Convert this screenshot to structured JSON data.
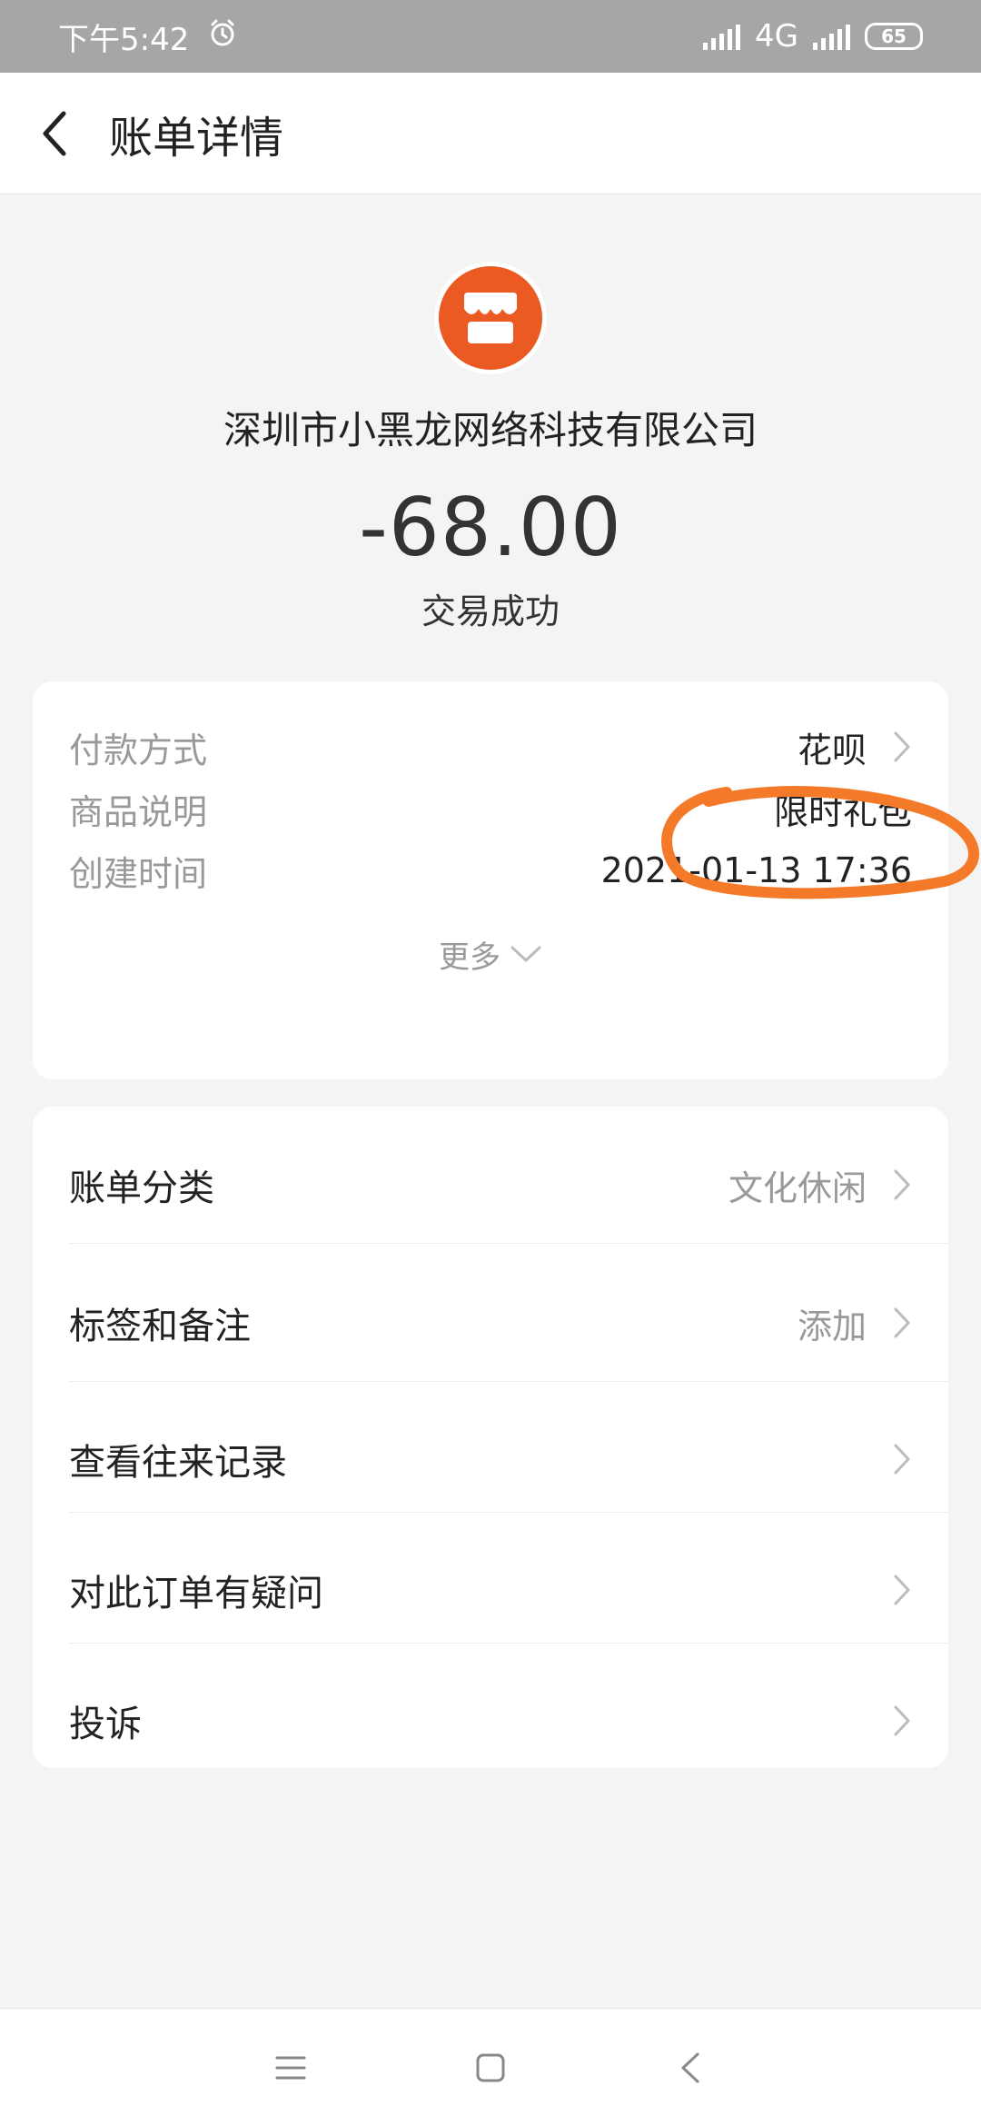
{
  "status_bar": {
    "time": "下午5:42",
    "network": "4G",
    "battery": "65",
    "icons": [
      "alarm-icon",
      "signal-icon",
      "battery-icon"
    ]
  },
  "header": {
    "title": "账单详情",
    "back_icon": "chevron-left-icon"
  },
  "merchant": {
    "name": "深圳市小黑龙网络科技有限公司",
    "amount": "-68.00",
    "status": "交易成功",
    "icon": "shop-icon",
    "icon_color": "#ec5a24"
  },
  "details": {
    "payment_label": "付款方式",
    "payment_value": "花呗",
    "product_label": "商品说明",
    "product_value": "限时礼包",
    "created_label": "创建时间",
    "created_value": "2021-01-13 17:36",
    "more_label": "更多"
  },
  "actions": {
    "category_label": "账单分类",
    "category_value": "文化休闲",
    "tags_label": "标签和备注",
    "tags_value": "添加",
    "history_label": "查看往来记录",
    "question_label": "对此订单有疑问",
    "complaint_label": "投诉"
  },
  "annotation_color": "#f47a2a"
}
